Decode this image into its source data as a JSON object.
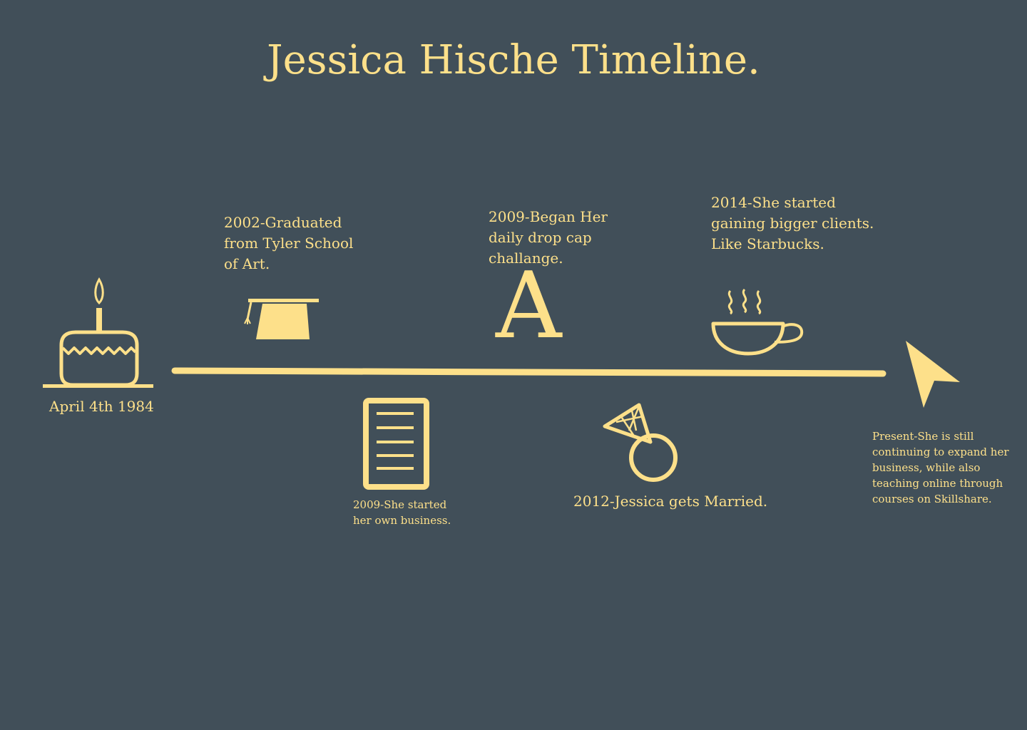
{
  "title": "Jessica Hische Timeline.",
  "colors": {
    "background": "#414f59",
    "accent": "#fde08a"
  },
  "events": {
    "birth": {
      "icon": "birthday-cake-icon",
      "text": "April 4th 1984"
    },
    "graduation": {
      "icon": "graduation-cap-icon",
      "text": "2002-Graduated\nfrom Tyler School\nof Art."
    },
    "business": {
      "icon": "document-icon",
      "text": "2009-She started\nher own business."
    },
    "drop_cap": {
      "icon": "drop-cap-letter-icon",
      "letter": "A",
      "text": "2009-Began Her\ndaily drop cap\nchallange."
    },
    "married": {
      "icon": "diamond-ring-icon",
      "text": "2012-Jessica gets Married."
    },
    "clients": {
      "icon": "coffee-cup-icon",
      "text": "2014-She started\ngaining bigger clients.\nLike Starbucks."
    },
    "present": {
      "icon": "cursor-arrow-icon",
      "text": "Present-She is still\ncontinuing to expand her\nbusiness, while also\nteaching online through\ncourses on Skillshare."
    }
  }
}
